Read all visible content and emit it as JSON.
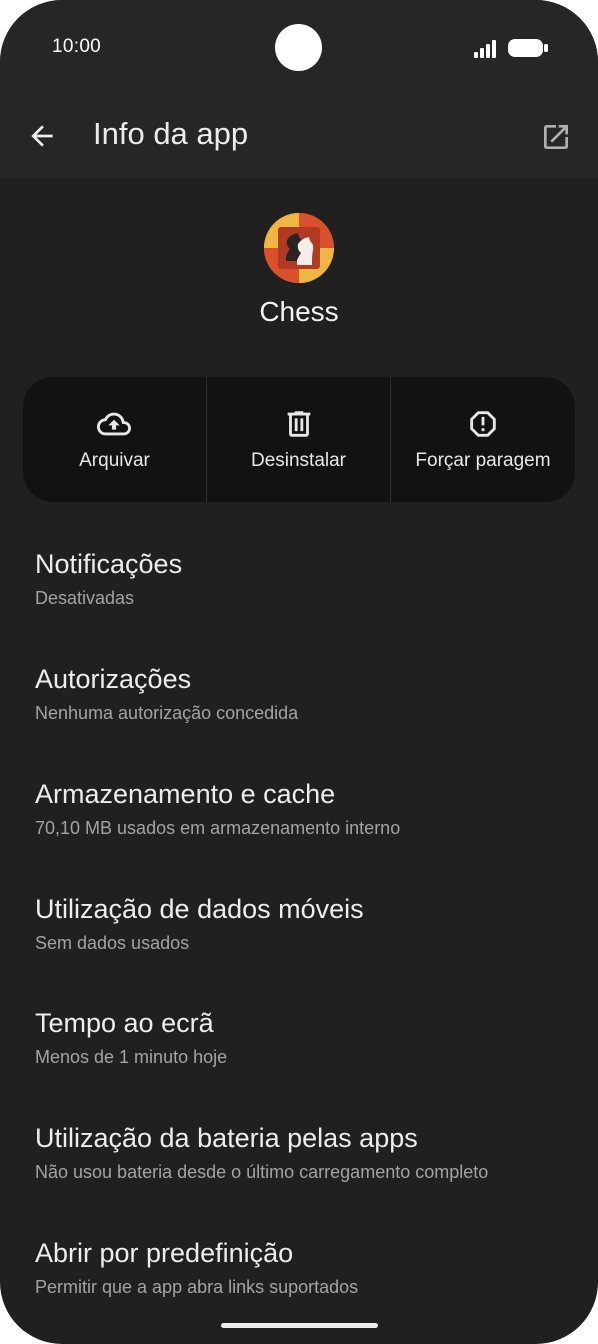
{
  "status_bar": {
    "time": "10:00"
  },
  "app_bar": {
    "title": "Info da app"
  },
  "app": {
    "name": "Chess"
  },
  "actions": [
    {
      "label": "Arquivar",
      "icon": "cloud-upload-icon"
    },
    {
      "label": "Desinstalar",
      "icon": "trash-icon"
    },
    {
      "label": "Forçar paragem",
      "icon": "alert-octagon-icon"
    }
  ],
  "settings": [
    {
      "title": "Notificações",
      "subtitle": "Desativadas"
    },
    {
      "title": "Autorizações",
      "subtitle": "Nenhuma autorização concedida"
    },
    {
      "title": "Armazenamento e cache",
      "subtitle": "70,10 MB usados em armazenamento interno"
    },
    {
      "title": "Utilização de dados móveis",
      "subtitle": "Sem dados usados"
    },
    {
      "title": "Tempo ao ecrã",
      "subtitle": "Menos de 1 minuto hoje"
    },
    {
      "title": "Utilização da bateria pelas apps",
      "subtitle": "Não usou bateria desde o último carregamento completo"
    },
    {
      "title": "Abrir por predefinição",
      "subtitle": "Permitir que a app abra links suportados"
    }
  ],
  "colors": {
    "background": "#202020",
    "bar": "#262626",
    "panel": "#121212",
    "text": "#ececec",
    "subtext": "#a3a3a3"
  }
}
